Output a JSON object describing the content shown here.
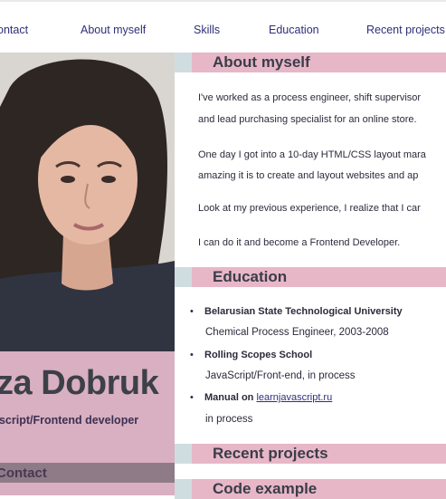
{
  "nav": {
    "items": [
      {
        "label": "ontact"
      },
      {
        "label": "About myself"
      },
      {
        "label": "Skills"
      },
      {
        "label": "Education"
      },
      {
        "label": "Recent projects"
      }
    ]
  },
  "profile": {
    "name": "iza Dobruk",
    "role": "ascript/Frontend developer",
    "contact_heading": "Contact"
  },
  "about": {
    "heading": "About myself",
    "paragraphs": [
      "I've worked as a process engineer, shift supervisor",
      "and lead purchasing specialist for an online store.",
      "One day I got into a 10-day HTML/CSS layout mara",
      "amazing it is to create and layout websites and ap",
      "Look at my previous experience, I realize that I car",
      "I can do it and become a Frontend Developer."
    ]
  },
  "education": {
    "heading": "Education",
    "items": [
      {
        "title": "Belarusian State Technological University",
        "detail": "Chemical Process Engineer, 2003-2008"
      },
      {
        "title": "Rolling Scopes School",
        "detail": "JavaScript/Front-end, in process"
      },
      {
        "title_prefix": "Manual on ",
        "link": "learnjavascript.ru",
        "detail": "in process"
      }
    ]
  },
  "sections": {
    "recent_projects": "Recent projects",
    "code_example": "Code example"
  },
  "colors": {
    "heading_bar": "#e7b7c8",
    "sidebar": "#d8b0c1",
    "nav_text": "#2f2f7a"
  }
}
